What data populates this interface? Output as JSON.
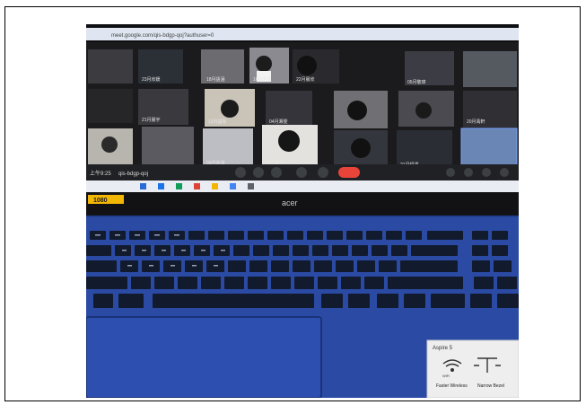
{
  "photo": {
    "url_text": "meet.google.com/qis-bdgp-qoj?authuser=0",
    "meeting_id": "qis-bdgp-qoj",
    "time_prefix": "上午9:25",
    "brand": "acer",
    "resolution_badge": "1080",
    "sticker": {
      "line1": "Aspire 5",
      "label_left": "Faster Wireless",
      "label_right": "Narrow Bezel",
      "wifi_label": "WiFi"
    },
    "tile_labels": [
      "23月欣媛",
      "18月語涵",
      "16號芊恩",
      "22月晨欣",
      "05月敬瑋",
      "21月晨宇",
      "12月語彤",
      "04月湘雯",
      "20月禹軒",
      "09月詠淇",
      "08月俊杰",
      "21月紹澤"
    ],
    "colors": {
      "keyboard": "#27449a",
      "keys": "#121a2e",
      "screen_bg": "#1b1b1d",
      "end_call": "#e8443a"
    }
  }
}
